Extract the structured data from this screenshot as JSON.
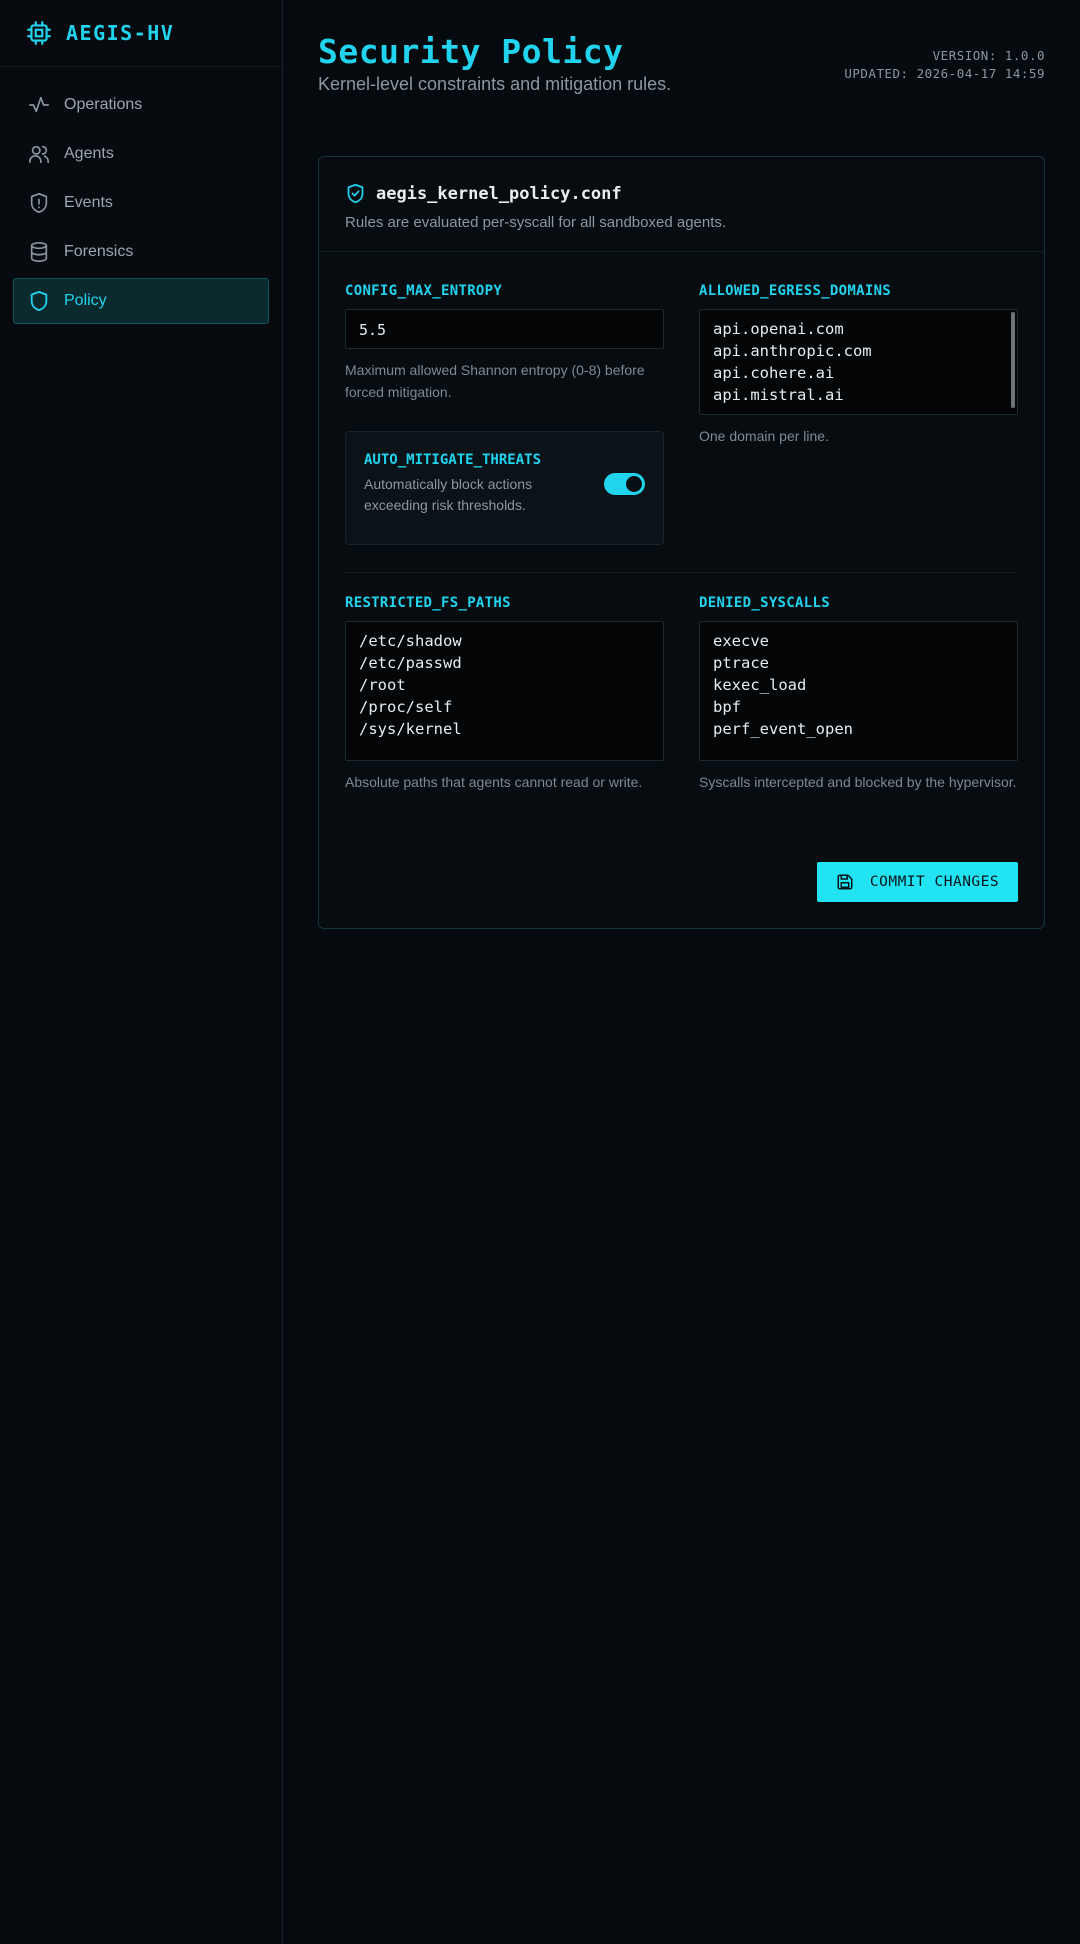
{
  "brand": {
    "name": "AEGIS-HV",
    "icon": "cpu-chip-icon"
  },
  "sidebar": {
    "items": [
      {
        "label": "Operations",
        "icon": "activity-icon",
        "active": false
      },
      {
        "label": "Agents",
        "icon": "users-icon",
        "active": false
      },
      {
        "label": "Events",
        "icon": "shield-alert-icon",
        "active": false
      },
      {
        "label": "Forensics",
        "icon": "database-icon",
        "active": false
      },
      {
        "label": "Policy",
        "icon": "shield-icon",
        "active": true
      }
    ]
  },
  "header": {
    "title": "Security Policy",
    "subtitle": "Kernel-level constraints and mitigation rules.",
    "version": "VERSION: 1.0.0",
    "updated": "UPDATED: 2026-04-17 14:59"
  },
  "card": {
    "title": "aegis_kernel_policy.conf",
    "description": "Rules are evaluated per-syscall for all sandboxed agents."
  },
  "fields": {
    "max_entropy": {
      "label": "CONFIG_MAX_ENTROPY",
      "value": "5.5",
      "help": "Maximum allowed Shannon entropy (0-8) before forced mitigation."
    },
    "egress": {
      "label": "ALLOWED_EGRESS_DOMAINS",
      "lines": [
        "api.openai.com",
        "api.anthropic.com",
        "api.cohere.ai",
        "api.mistral.ai"
      ],
      "help": "One domain per line."
    },
    "auto_mitigate": {
      "label": "AUTO_MITIGATE_THREATS",
      "description": "Automatically block actions exceeding risk thresholds.",
      "enabled": true
    },
    "fs_paths": {
      "label": "RESTRICTED_FS_PATHS",
      "lines": [
        "/etc/shadow",
        "/etc/passwd",
        "/root",
        "/proc/self",
        "/sys/kernel"
      ],
      "help": "Absolute paths that agents cannot read or write."
    },
    "syscalls": {
      "label": "DENIED_SYSCALLS",
      "lines": [
        "execve",
        "ptrace",
        "kexec_load",
        "bpf",
        "perf_event_open"
      ],
      "help": "Syscalls intercepted and blocked by the hypervisor."
    }
  },
  "actions": {
    "commit_label": "COMMIT CHANGES",
    "commit_icon": "save-icon"
  },
  "colors": {
    "accent": "#22d3ee",
    "background": "#050a0e"
  }
}
